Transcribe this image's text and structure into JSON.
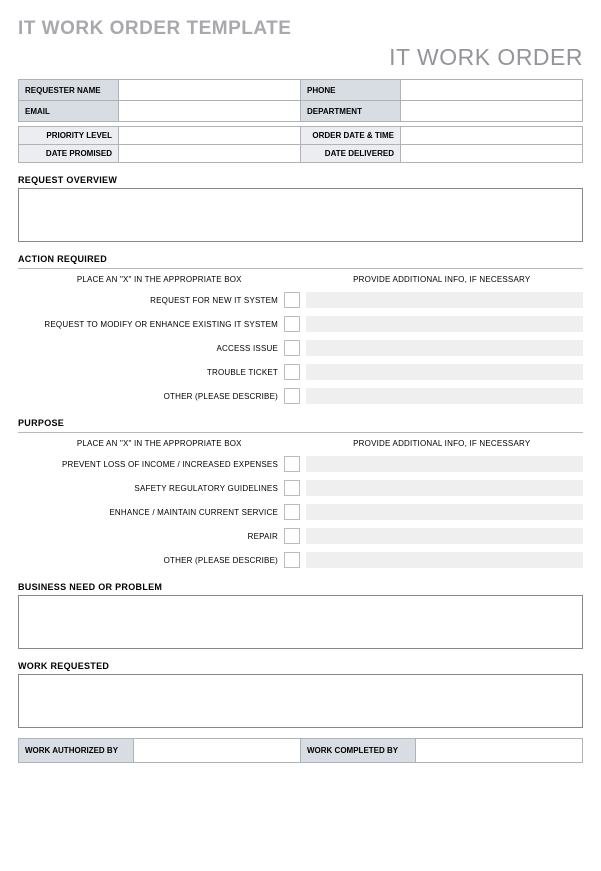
{
  "title": "IT WORK ORDER TEMPLATE",
  "subtitle": "IT WORK ORDER",
  "requester": {
    "name_label": "REQUESTER NAME",
    "phone_label": "PHONE",
    "email_label": "EMAIL",
    "dept_label": "DEPARTMENT",
    "name": "",
    "phone": "",
    "email": "",
    "dept": ""
  },
  "meta": {
    "priority_label": "PRIORITY LEVEL",
    "order_date_label": "ORDER DATE & TIME",
    "date_promised_label": "DATE PROMISED",
    "date_delivered_label": "DATE DELIVERED",
    "priority": "",
    "order_date": "",
    "date_promised": "",
    "date_delivered": ""
  },
  "sections": {
    "overview": "REQUEST OVERVIEW",
    "action": "ACTION REQUIRED",
    "purpose": "PURPOSE",
    "business": "BUSINESS NEED OR PROBLEM",
    "work": "WORK REQUESTED"
  },
  "check_headers": {
    "left": "PLACE AN \"X\" IN THE APPROPRIATE BOX",
    "right": "PROVIDE ADDITIONAL INFO, IF NECESSARY"
  },
  "action_items": [
    "REQUEST FOR NEW IT SYSTEM",
    "REQUEST TO MODIFY OR ENHANCE EXISTING IT SYSTEM",
    "ACCESS ISSUE",
    "TROUBLE TICKET",
    "OTHER (PLEASE DESCRIBE)"
  ],
  "purpose_items": [
    "PREVENT LOSS OF INCOME / INCREASED EXPENSES",
    "SAFETY REGULATORY GUIDELINES",
    "ENHANCE / MAINTAIN CURRENT SERVICE",
    "REPAIR",
    "OTHER (PLEASE DESCRIBE)"
  ],
  "signatures": {
    "auth_label": "WORK AUTHORIZED BY",
    "comp_label": "WORK COMPLETED BY",
    "auth": "",
    "comp": ""
  }
}
